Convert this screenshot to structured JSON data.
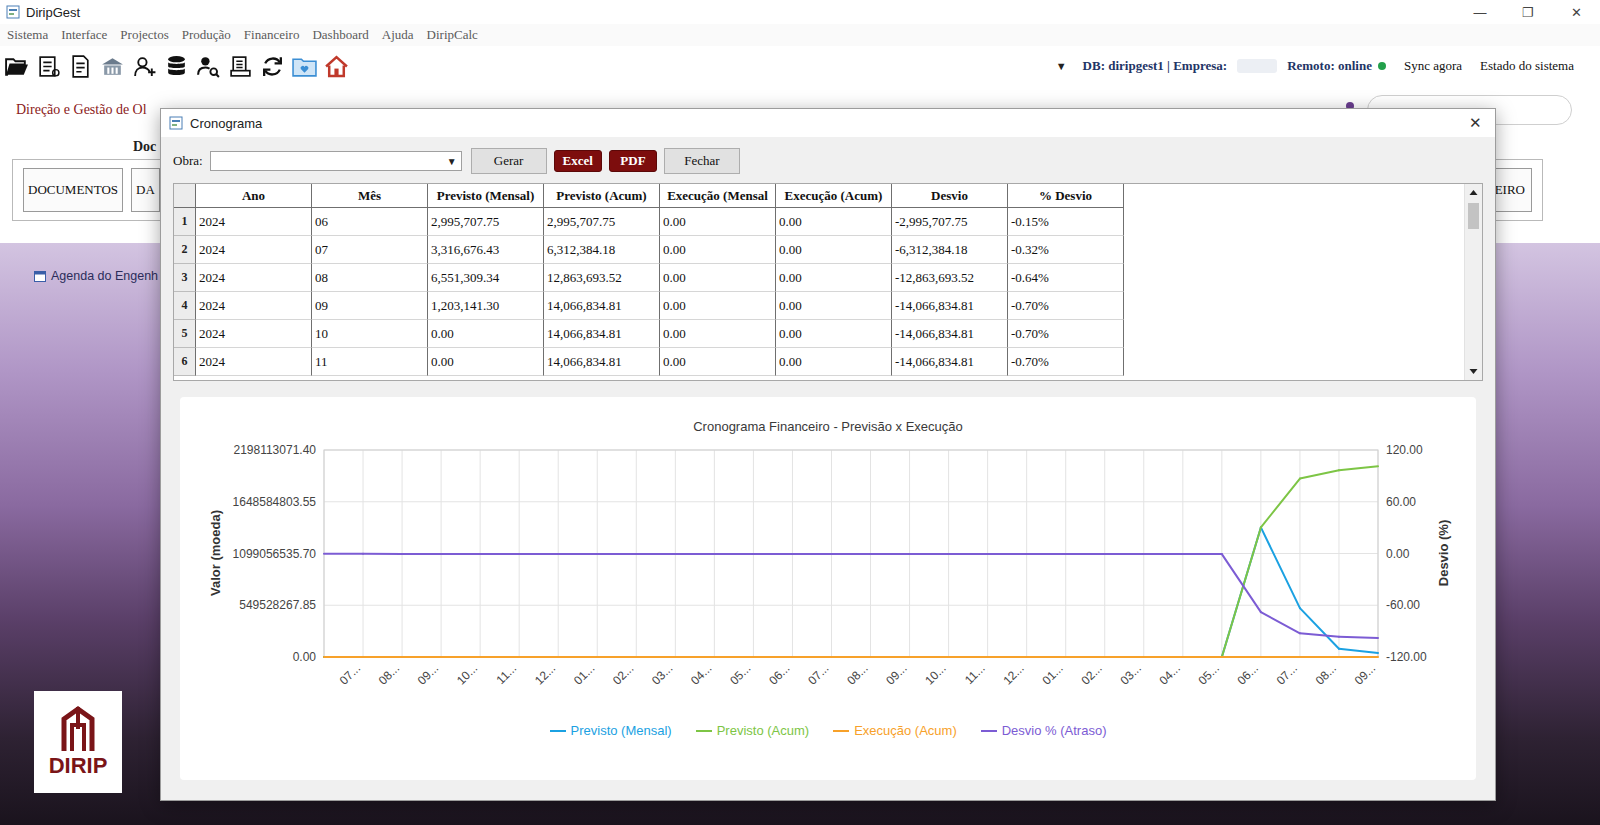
{
  "window": {
    "title": "DiripGest",
    "controls": [
      "—",
      "❐",
      "✕"
    ]
  },
  "menu": [
    "Sistema",
    "Interface",
    "Projectos",
    "Produção",
    "Financeiro",
    "Dashboard",
    "Ajuda",
    "DiripCalc"
  ],
  "status": {
    "dropdown_arrow": "▼",
    "db": "DB: diripgest1 | Empresa:",
    "remote": "Remoto: online",
    "online": true,
    "sync": "Sync agora",
    "system": "Estado do sistema"
  },
  "background": {
    "heading": "Direção e Gestão de Ol",
    "section_label": "Doc",
    "buttons": [
      "DOCUMENTOS",
      "DA",
      "EIRO"
    ],
    "agenda": "Agenda do Engenh",
    "logo": "DIRIP"
  },
  "dialog": {
    "title": "Cronograma",
    "close": "✕",
    "obra_label": "Obra:",
    "combo_arrow": "▼",
    "buttons": [
      {
        "label": "Gerar",
        "kind": "plain"
      },
      {
        "label": "Excel",
        "kind": "accent"
      },
      {
        "label": "PDF",
        "kind": "accent"
      },
      {
        "label": "Fechar",
        "kind": "plain"
      }
    ],
    "table": {
      "columns": [
        "Ano",
        "Mês",
        "Previsto (Mensal)",
        "Previsto (Acum)",
        "Execução (Mensal",
        "Execução (Acum)",
        "Desvio",
        "% Desvio"
      ],
      "rows": [
        {
          "n": "1",
          "cells": [
            "2024",
            "06",
            "2,995,707.75",
            "2,995,707.75",
            "0.00",
            "0.00",
            "-2,995,707.75",
            "-0.15%"
          ]
        },
        {
          "n": "2",
          "cells": [
            "2024",
            "07",
            "3,316,676.43",
            "6,312,384.18",
            "0.00",
            "0.00",
            "-6,312,384.18",
            "-0.32%"
          ]
        },
        {
          "n": "3",
          "cells": [
            "2024",
            "08",
            "6,551,309.34",
            "12,863,693.52",
            "0.00",
            "0.00",
            "-12,863,693.52",
            "-0.64%"
          ]
        },
        {
          "n": "4",
          "cells": [
            "2024",
            "09",
            "1,203,141.30",
            "14,066,834.81",
            "0.00",
            "0.00",
            "-14,066,834.81",
            "-0.70%"
          ]
        },
        {
          "n": "5",
          "cells": [
            "2024",
            "10",
            "0.00",
            "14,066,834.81",
            "0.00",
            "0.00",
            "-14,066,834.81",
            "-0.70%"
          ]
        },
        {
          "n": "6",
          "cells": [
            "2024",
            "11",
            "0.00",
            "14,066,834.81",
            "0.00",
            "0.00",
            "-14,066,834.81",
            "-0.70%"
          ]
        }
      ]
    },
    "chart": {
      "title": "Cronograma Financeiro - Previsão x Execução",
      "y_left": {
        "title": "Valor (moeda)",
        "min": 0,
        "max": 2198113071.4,
        "ticks": [
          "2198113071.40",
          "1648584803.55",
          "1099056535.70",
          "549528267.85",
          "0.00"
        ]
      },
      "y_right": {
        "title": "Desvio (%)",
        "min": -120,
        "max": 120,
        "ticks": [
          "120.00",
          "60.00",
          "0.00",
          "-60.00",
          "-120.00"
        ]
      },
      "x_labels": [
        "07...",
        "08...",
        "09...",
        "10...",
        "11...",
        "12...",
        "01...",
        "02...",
        "03...",
        "04...",
        "05...",
        "06...",
        "07...",
        "08...",
        "09...",
        "10...",
        "11...",
        "12...",
        "01...",
        "02...",
        "03...",
        "04...",
        "05...",
        "06...",
        "07...",
        "08...",
        "09..."
      ],
      "series": [
        {
          "name": "Previsto (Mensal)",
          "color": "#1ba1e2",
          "axis": "left",
          "values": [
            0,
            0,
            0,
            0,
            0,
            0,
            0,
            0,
            0,
            0,
            0,
            0,
            0,
            0,
            0,
            0,
            0,
            0,
            0,
            0,
            0,
            0,
            0,
            0,
            1376000000,
            519000000,
            87000000,
            43000000
          ]
        },
        {
          "name": "Previsto (Acum)",
          "color": "#7dc545",
          "axis": "left",
          "values": [
            0,
            0,
            0,
            0,
            0,
            0,
            0,
            0,
            0,
            0,
            0,
            0,
            0,
            0,
            0,
            0,
            0,
            0,
            0,
            0,
            0,
            0,
            0,
            0,
            1376000000,
            1895000000,
            1982000000,
            2025000000
          ]
        },
        {
          "name": "Execução (Acum)",
          "color": "#f7a12a",
          "axis": "left",
          "values": [
            0,
            0,
            0,
            0,
            0,
            0,
            0,
            0,
            0,
            0,
            0,
            0,
            0,
            0,
            0,
            0,
            0,
            0,
            0,
            0,
            0,
            0,
            0,
            0,
            0,
            0,
            0,
            0
          ]
        },
        {
          "name": "Desvio % (Atraso)",
          "color": "#7c5cd4",
          "axis": "right",
          "values": [
            -0.15,
            -0.32,
            -0.64,
            -0.7,
            -0.7,
            -0.7,
            -0.7,
            -0.7,
            -0.7,
            -0.7,
            -0.7,
            -0.7,
            -0.7,
            -0.7,
            -0.7,
            -0.7,
            -0.7,
            -0.7,
            -0.7,
            -0.7,
            -0.7,
            -0.7,
            -0.7,
            -0.7,
            -68,
            -92.5,
            -96.5,
            -98
          ]
        }
      ]
    }
  }
}
